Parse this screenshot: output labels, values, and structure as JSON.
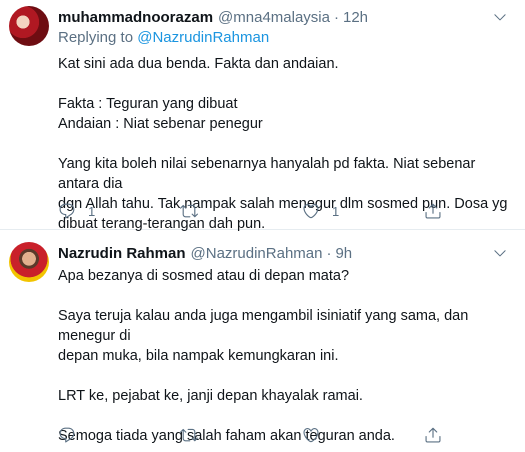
{
  "tweets": [
    {
      "name": "muhammadnoorazam",
      "handle": "@mna4malaysia",
      "separator": "·",
      "time": "12h",
      "replying_prefix": "Replying to",
      "replying_handle": "@NazrudinRahman",
      "lines": [
        "Kat sini ada dua benda. Fakta dan andaian.",
        "",
        "Fakta : Teguran yang dibuat",
        "Andaian : Niat sebenar penegur",
        "",
        "Yang kita boleh nilai sebenarnya hanyalah pd fakta. Niat sebenar antara dia",
        "dgn Allah tahu. Tak nampak salah menegur dlm sosmed pun. Dosa yg",
        "dibuat terang-terangan dah pun."
      ],
      "reply_count": "1",
      "retweet_count": "",
      "like_count": "1"
    },
    {
      "name": "Nazrudin Rahman",
      "handle": "@NazrudinRahman",
      "separator": "·",
      "time": "9h",
      "lines": [
        "Apa bezanya di sosmed atau di depan mata?",
        "",
        "Saya teruja kalau anda juga mengambil isiniatif yang sama, dan menegur di",
        "depan muka, bila nampak kemungkaran ini.",
        "",
        "LRT ke, pejabat ke, janji depan khayalak ramai.",
        "",
        "Semoga tiada yang salah faham akan teguran anda."
      ],
      "reply_count": "",
      "retweet_count": "",
      "like_count": ""
    }
  ]
}
